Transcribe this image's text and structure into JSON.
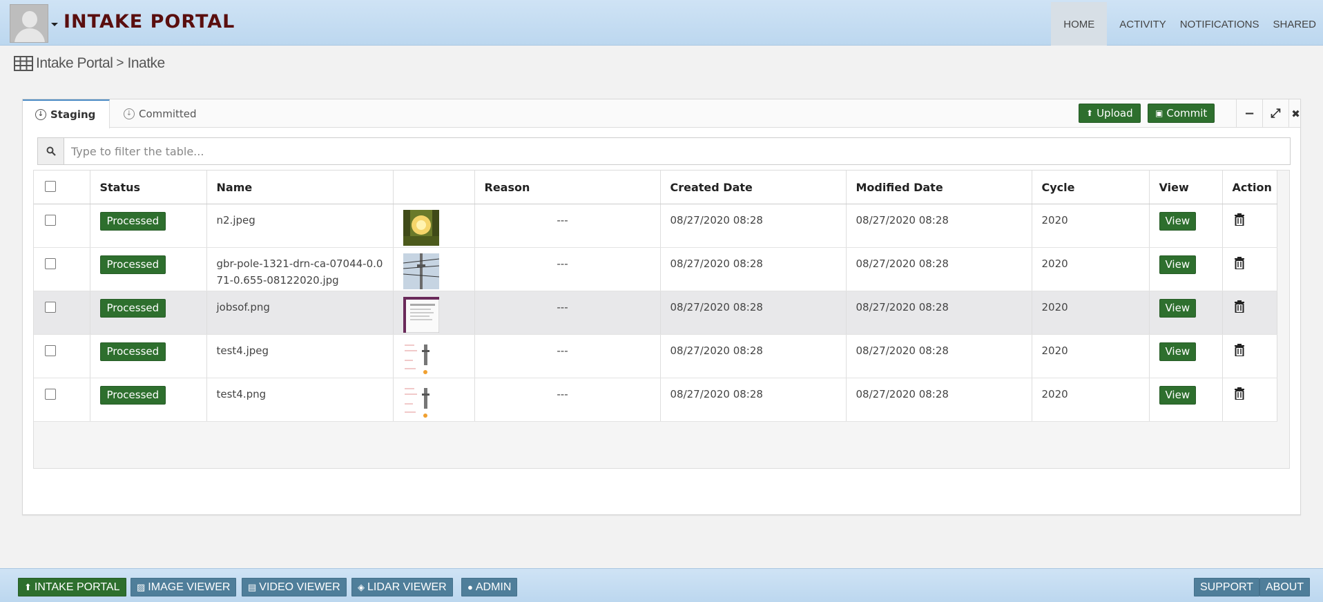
{
  "header": {
    "brand": "INTAKE PORTAL",
    "nav": [
      {
        "label": "HOME",
        "active": true
      },
      {
        "label": "ACTIVITY"
      },
      {
        "label": "NOTIFICATIONS"
      },
      {
        "label": "SHARED"
      }
    ]
  },
  "breadcrumb": {
    "root": "Intake Portal",
    "separator": ">",
    "current": "Inatke"
  },
  "panel": {
    "tabs": [
      {
        "label": "Staging",
        "active": true
      },
      {
        "label": "Committed"
      }
    ],
    "actions": {
      "upload": "Upload",
      "commit": "Commit"
    },
    "controls": {
      "minimize": "−",
      "expand": "⤢",
      "close": "✖"
    }
  },
  "search": {
    "placeholder": "Type to filter the table..."
  },
  "table": {
    "columns": [
      "",
      "Status",
      "Name",
      "",
      "Reason",
      "Created Date",
      "Modified Date",
      "Cycle",
      "View",
      "Action"
    ],
    "rows": [
      {
        "status": "Processed",
        "name": "n2.jpeg",
        "reason": "---",
        "created": "08/27/2020 08:28",
        "modified": "08/27/2020 08:28",
        "cycle": "2020",
        "view": "View",
        "thumb": "sunset-trees"
      },
      {
        "status": "Processed",
        "name": "gbr-pole-1321-drn-ca-07044-0.071-0.655-08122020.jpg",
        "reason": "---",
        "created": "08/27/2020 08:28",
        "modified": "08/27/2020 08:28",
        "cycle": "2020",
        "view": "View",
        "thumb": "utility-pole"
      },
      {
        "status": "Processed",
        "name": "jobsof.png",
        "reason": "---",
        "created": "08/27/2020 08:28",
        "modified": "08/27/2020 08:28",
        "cycle": "2020",
        "view": "View",
        "thumb": "document-screenshot"
      },
      {
        "status": "Processed",
        "name": "test4.jpeg",
        "reason": "---",
        "created": "08/27/2020 08:28",
        "modified": "08/27/2020 08:28",
        "cycle": "2020",
        "view": "View",
        "thumb": "report-page"
      },
      {
        "status": "Processed",
        "name": "test4.png",
        "reason": "---",
        "created": "08/27/2020 08:28",
        "modified": "08/27/2020 08:28",
        "cycle": "2020",
        "view": "View",
        "thumb": "report-page"
      }
    ]
  },
  "footer": {
    "left": [
      {
        "label": "INTAKE PORTAL",
        "icon": "upload-icon",
        "primary": true
      },
      {
        "label": "IMAGE VIEWER",
        "icon": "image-icon"
      },
      {
        "label": "VIDEO VIEWER",
        "icon": "file-icon"
      },
      {
        "label": "LIDAR VIEWER",
        "icon": "cube-icon"
      },
      {
        "label": "ADMIN",
        "icon": "user-icon"
      }
    ],
    "right": [
      {
        "label": "SUPPORT"
      },
      {
        "label": "ABOUT"
      }
    ]
  },
  "colors": {
    "primary_green": "#2e6f2e",
    "brand_text": "#5a0e0e",
    "header_blue": "#c8def2",
    "footer_button": "#4f7e9a"
  }
}
